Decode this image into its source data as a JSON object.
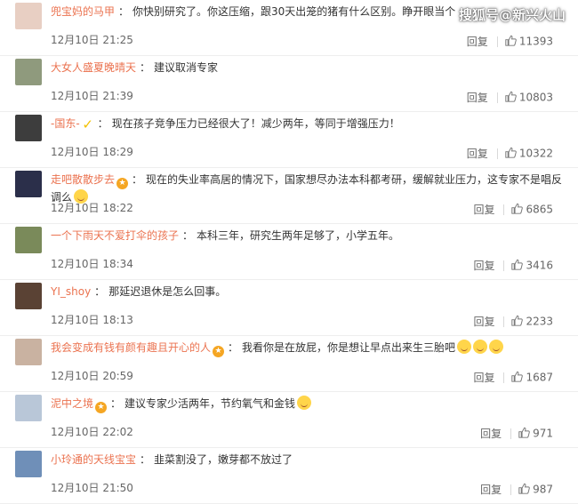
{
  "watermark": "搜狐号@新兴火山",
  "ui": {
    "reply_label": "回复"
  },
  "colors": {
    "username": "#eb7350",
    "meta": "#666666",
    "text": "#333333"
  },
  "comments": [
    {
      "user": "兜宝妈的马甲",
      "badge": "",
      "text": "你快别研究了。你这压缩，跟30天出笼的猪有什么区别。睁开眼当个",
      "emojis": [],
      "time": "12月10日 21:25",
      "likes": "11393",
      "avatar_color": "#e8cfc3"
    },
    {
      "user": "大女人盛夏晚晴天",
      "badge": "",
      "text": "建议取消专家",
      "emojis": [],
      "time": "12月10日 21:39",
      "likes": "10803",
      "avatar_color": "#8f9a7d"
    },
    {
      "user": "-国东-",
      "badge": "v-icon",
      "text": "现在孩子竞争压力已经很大了！减少两年，等同于增强压力！",
      "emojis": [],
      "time": "12月10日 18:29",
      "likes": "10322",
      "avatar_color": "#3d3d3d"
    },
    {
      "user": "走吧散散步去",
      "badge": "vip-icon",
      "text": "现在的失业率高居的情况下，国家想尽办法本科都考研，缓解就业压力，这专家不是唱反调么",
      "emojis": [
        "laugh-emoji"
      ],
      "time": "12月10日 18:22",
      "likes": "6865",
      "avatar_color": "#2b2f4a"
    },
    {
      "user": "一个下雨天不爱打伞的孩子",
      "badge": "",
      "text": "本科三年，研究生两年足够了，小学五年。",
      "emojis": [],
      "time": "12月10日 18:34",
      "likes": "3416",
      "avatar_color": "#7a8a5a"
    },
    {
      "user": "YI_shoy",
      "badge": "",
      "text": "那延迟退休是怎么回事。",
      "emojis": [],
      "time": "12月10日 18:13",
      "likes": "2233",
      "avatar_color": "#5a4234"
    },
    {
      "user": "我会变成有钱有颜有趣且开心的人",
      "badge": "vip-icon",
      "text": "我看你是在放屁，你是想让早点出来生三胎吧",
      "emojis": [
        "smile-emoji",
        "smile-emoji",
        "smile-emoji"
      ],
      "time": "12月10日 20:59",
      "likes": "1687",
      "avatar_color": "#c9b2a1"
    },
    {
      "user": "泥中之境",
      "badge": "vip-icon",
      "text": "建议专家少活两年，节约氧气和金钱",
      "emojis": [
        "sad-emoji"
      ],
      "time": "12月10日 22:02",
      "likes": "971",
      "avatar_color": "#b9c7d8"
    },
    {
      "user": "小玲通的天线宝宝",
      "badge": "",
      "text": "韭菜割没了，嫩芽都不放过了",
      "emojis": [],
      "time": "12月10日 21:50",
      "likes": "987",
      "avatar_color": "#6f8fb8"
    }
  ]
}
